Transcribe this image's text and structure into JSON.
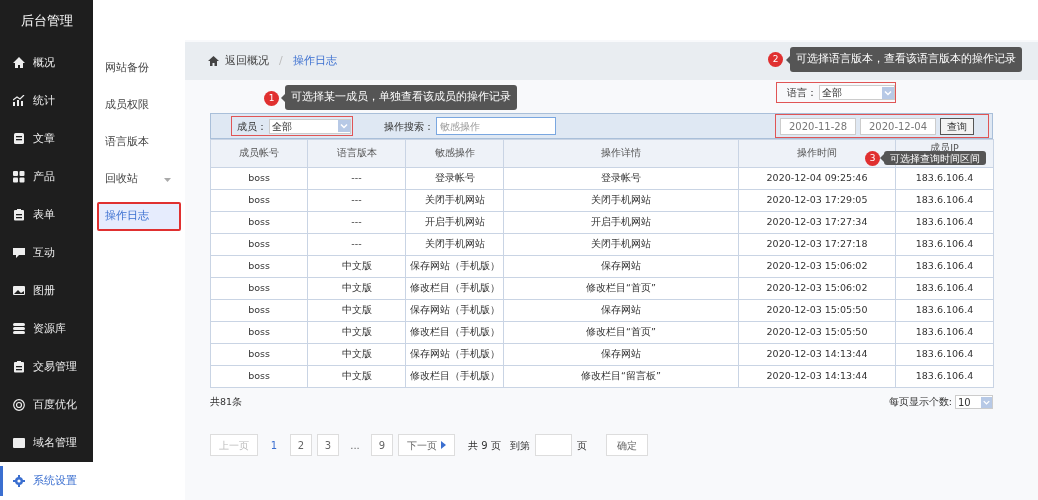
{
  "app_title": "后台管理",
  "sidebar": {
    "items": [
      {
        "label": "概况",
        "selected": false
      },
      {
        "label": "统计",
        "selected": false
      },
      {
        "label": "文章",
        "selected": false
      },
      {
        "label": "产品",
        "selected": false
      },
      {
        "label": "表单",
        "selected": false
      },
      {
        "label": "互动",
        "selected": false
      },
      {
        "label": "图册",
        "selected": false
      },
      {
        "label": "资源库",
        "selected": false
      },
      {
        "label": "交易管理",
        "selected": false
      },
      {
        "label": "百度优化",
        "selected": false
      },
      {
        "label": "域名管理",
        "selected": false
      },
      {
        "label": "系统设置",
        "selected": true
      }
    ]
  },
  "subnav": {
    "items": [
      {
        "label": "网站备份",
        "selected": false,
        "has_submenu": false,
        "highlighted": false
      },
      {
        "label": "成员权限",
        "selected": false,
        "has_submenu": false,
        "highlighted": false
      },
      {
        "label": "语言版本",
        "selected": false,
        "has_submenu": false,
        "highlighted": false
      },
      {
        "label": "回收站",
        "selected": false,
        "has_submenu": true,
        "highlighted": false
      },
      {
        "label": "操作日志",
        "selected": true,
        "has_submenu": false,
        "highlighted": true
      }
    ]
  },
  "breadcrumb": {
    "back": "返回概况",
    "separator": "/",
    "current": "操作日志"
  },
  "language_filter": {
    "label": "语言：",
    "value": "全部"
  },
  "filters": {
    "member_label": "成员：",
    "member_value": "全部",
    "search_label": "操作搜索：",
    "search_placeholder": "敏感操作",
    "date_from": "2020-11-28",
    "date_to": "2020-12-04",
    "query_button": "查询"
  },
  "table": {
    "columns": [
      "成员帐号",
      "语言版本",
      "敏感操作",
      "操作详情",
      "操作时间",
      "成员IP"
    ],
    "rows": [
      [
        "boss",
        "---",
        "登录帐号",
        "登录帐号",
        "2020-12-04 09:25:46",
        "183.6.106.4"
      ],
      [
        "boss",
        "---",
        "关闭手机网站",
        "关闭手机网站",
        "2020-12-03 17:29:05",
        "183.6.106.4"
      ],
      [
        "boss",
        "---",
        "开启手机网站",
        "开启手机网站",
        "2020-12-03 17:27:34",
        "183.6.106.4"
      ],
      [
        "boss",
        "---",
        "关闭手机网站",
        "关闭手机网站",
        "2020-12-03 17:27:18",
        "183.6.106.4"
      ],
      [
        "boss",
        "中文版",
        "保存网站（手机版）",
        "保存网站",
        "2020-12-03 15:06:02",
        "183.6.106.4"
      ],
      [
        "boss",
        "中文版",
        "修改栏目（手机版）",
        "修改栏目“首页”",
        "2020-12-03 15:06:02",
        "183.6.106.4"
      ],
      [
        "boss",
        "中文版",
        "保存网站（手机版）",
        "保存网站",
        "2020-12-03 15:05:50",
        "183.6.106.4"
      ],
      [
        "boss",
        "中文版",
        "修改栏目（手机版）",
        "修改栏目“首页”",
        "2020-12-03 15:05:50",
        "183.6.106.4"
      ],
      [
        "boss",
        "中文版",
        "保存网站（手机版）",
        "保存网站",
        "2020-12-03 14:13:44",
        "183.6.106.4"
      ],
      [
        "boss",
        "中文版",
        "修改栏目（手机版）",
        "修改栏目“留言板”",
        "2020-12-03 14:13:44",
        "183.6.106.4"
      ]
    ]
  },
  "total": "共81条",
  "page_size": {
    "label": "每页显示个数:",
    "value": "10"
  },
  "pagination": {
    "items": [
      {
        "kind": "prev",
        "label": "上一页",
        "selected": false,
        "disabled": true
      },
      {
        "kind": "page",
        "label": "1",
        "selected": true,
        "disabled": false
      },
      {
        "kind": "page",
        "label": "2",
        "selected": false,
        "disabled": false
      },
      {
        "kind": "page",
        "label": "3",
        "selected": false,
        "disabled": false
      },
      {
        "kind": "ellipsis",
        "label": "...",
        "selected": false,
        "disabled": false
      },
      {
        "kind": "page",
        "label": "9",
        "selected": false,
        "disabled": false
      },
      {
        "kind": "next",
        "label": "下一页",
        "selected": false,
        "disabled": false
      }
    ],
    "total_pages": "共 9 页",
    "goto_label": "到第",
    "goto_suffix": "页",
    "confirm": "确定"
  },
  "annotations": [
    {
      "number": "1",
      "text": "可选择某一成员，单独查看该成员的操作记录"
    },
    {
      "number": "2",
      "text": "可选择语言版本，查看该语言版本的操作记录"
    },
    {
      "number": "3",
      "text": "可选择查询时间区间"
    }
  ]
}
